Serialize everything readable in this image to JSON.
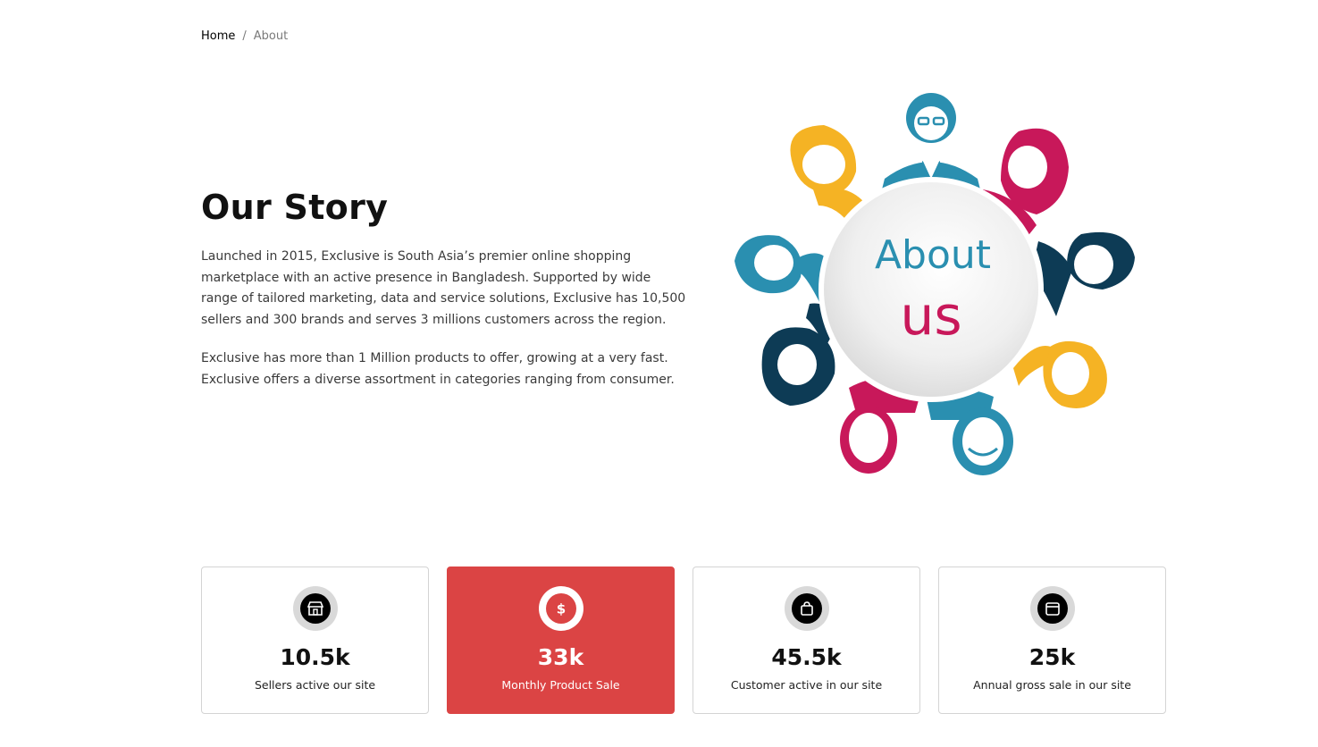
{
  "breadcrumb": {
    "home": "Home",
    "separator": "/",
    "current": "About"
  },
  "story": {
    "title": "Our Story",
    "paragraph1": "Launched in 2015, Exclusive is South Asia’s premier online shopping marketplace with an active presence in Bangladesh. Supported by wide range of tailored marketing, data and service solutions, Exclusive has 10,500 sellers and 300 brands and serves 3 millions customers across the region.",
    "paragraph2": "Exclusive has more than 1 Million products to offer, growing at a very fast. Exclusive offers a diverse assortment in categories ranging from consumer."
  },
  "illustration": {
    "line1": "About",
    "line2": "us",
    "colors": {
      "teal": "#2a8fb0",
      "pink": "#c8185a",
      "yellow": "#f5b324",
      "navy": "#0d3b55"
    }
  },
  "stats": [
    {
      "icon": "shop-icon",
      "value": "10.5k",
      "label": "Sellers active our site"
    },
    {
      "icon": "dollar-icon",
      "value": "33k",
      "label": "Monthly Product Sale"
    },
    {
      "icon": "shopping-bag-icon",
      "value": "45.5k",
      "label": "Customer active in our site"
    },
    {
      "icon": "money-bag-icon",
      "value": "25k",
      "label": "Annual gross sale in our site"
    }
  ],
  "accent_color": "#db4444"
}
